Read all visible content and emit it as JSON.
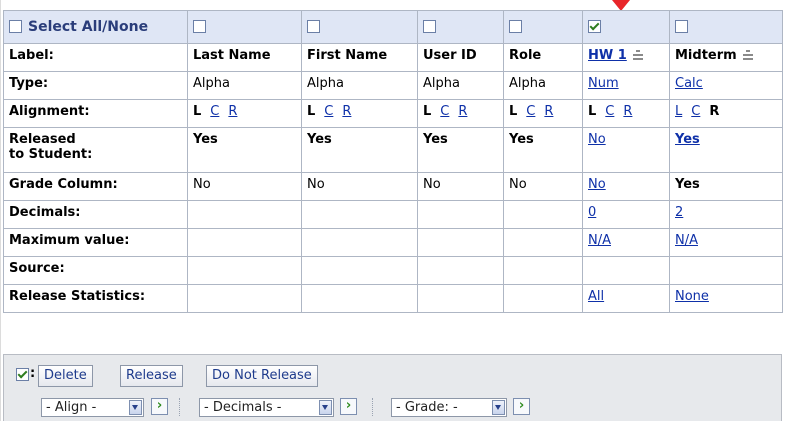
{
  "header": {
    "select_all_label": "Select All/None",
    "columns": [
      {
        "checked": false
      },
      {
        "checked": false
      },
      {
        "checked": false
      },
      {
        "checked": false
      },
      {
        "checked": true
      },
      {
        "checked": false
      }
    ]
  },
  "rows": {
    "label": {
      "label": "Label:",
      "values": [
        "Last Name",
        "First Name",
        "User ID",
        "Role",
        "HW 1",
        "Midterm"
      ]
    },
    "type": {
      "label": "Type:",
      "values": [
        "Alpha",
        "Alpha",
        "Alpha",
        "Alpha",
        "Num",
        "Calc"
      ]
    },
    "alignment": {
      "label": "Alignment:",
      "letters": [
        "L",
        "C",
        "R"
      ]
    },
    "released": {
      "label_line1": "Released",
      "label_line2": "to Student:",
      "values": [
        "Yes",
        "Yes",
        "Yes",
        "Yes",
        "No",
        "Yes"
      ]
    },
    "grade_column": {
      "label": "Grade Column:",
      "values": [
        "No",
        "No",
        "No",
        "No",
        "No",
        "Yes"
      ]
    },
    "decimals": {
      "label": "Decimals:",
      "values": [
        "",
        "",
        "",
        "",
        "0",
        "2"
      ]
    },
    "maximum_value": {
      "label": "Maximum value:",
      "values": [
        "",
        "",
        "",
        "",
        "N/A",
        "N/A"
      ]
    },
    "source": {
      "label": "Source:"
    },
    "release_statistics": {
      "label": "Release Statistics:",
      "values": [
        "",
        "",
        "",
        "",
        "All",
        "None"
      ]
    }
  },
  "toolbar": {
    "checkbox_suffix": ":",
    "delete_label": "Delete",
    "release_label": "Release",
    "do_not_release_label": "Do Not Release",
    "align_select": "- Align -",
    "decimals_select": "- Decimals -",
    "grade_select": "- Grade: -"
  },
  "colors": {
    "header_bg": "#dfe6f5",
    "link": "#0e30a8",
    "toolbar_bg": "#e7e9ec",
    "arrow": "#e8262a"
  }
}
